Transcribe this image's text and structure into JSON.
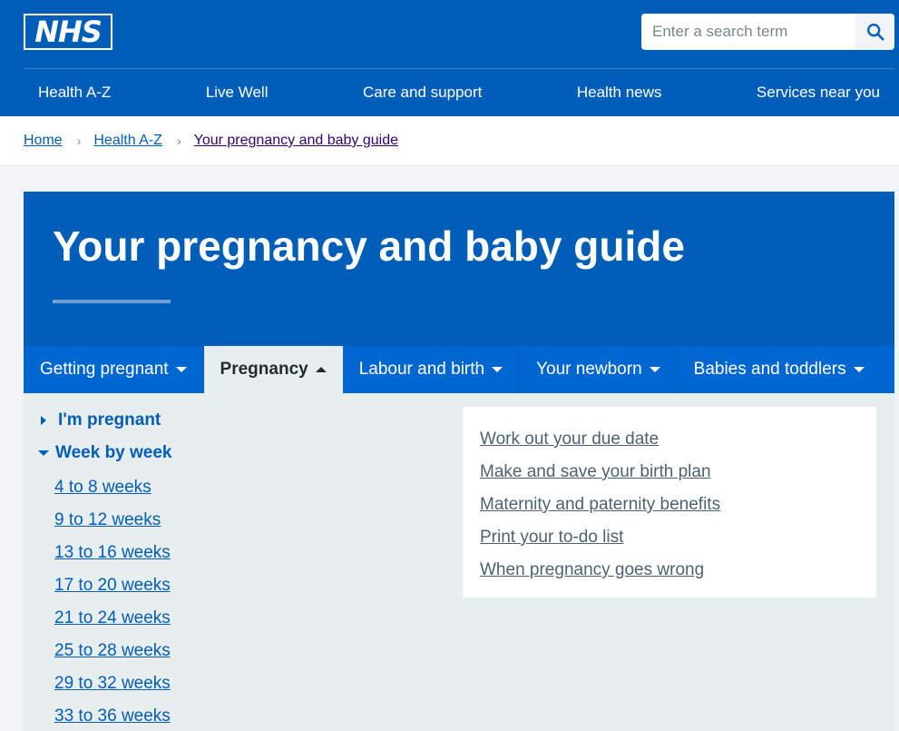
{
  "header": {
    "logo_text": "NHS",
    "search": {
      "placeholder": "Enter a search term"
    },
    "nav": [
      "Health A-Z",
      "Live Well",
      "Care and support",
      "Health news",
      "Services near you"
    ]
  },
  "breadcrumb": [
    "Home",
    "Health A-Z",
    "Your pregnancy and baby guide"
  ],
  "hero": {
    "title": "Your pregnancy and baby guide"
  },
  "tabs": [
    "Getting pregnant",
    "Pregnancy",
    "Labour and birth",
    "Your newborn",
    "Babies and toddlers"
  ],
  "active_tab": "Pregnancy",
  "menu": {
    "im_pregnant": "I'm pregnant",
    "week_by_week": "Week by week",
    "weeks": [
      "4 to 8 weeks",
      "9 to 12 weeks",
      "13 to 16 weeks",
      "17 to 20 weeks",
      "21 to 24 weeks",
      "25 to 28 weeks",
      "29 to 32 weeks",
      "33 to 36 weeks"
    ]
  },
  "quick_links": [
    "Work out your due date",
    "Make and save your birth plan",
    "Maternity and paternity benefits",
    "Print your to-do list",
    "When pregnancy goes wrong"
  ],
  "colors": {
    "nhs_blue": "#005eb8",
    "tab_blue": "#0067d1",
    "panel_bg": "#e8edee",
    "visited": "#330072"
  },
  "icons": {
    "search": "search-icon",
    "breadcrumb_separator": "chevron-right-icon",
    "tab_caret": "caret-down-icon",
    "menu_collapsed": "triangle-right-icon",
    "menu_expanded": "triangle-down-icon"
  }
}
